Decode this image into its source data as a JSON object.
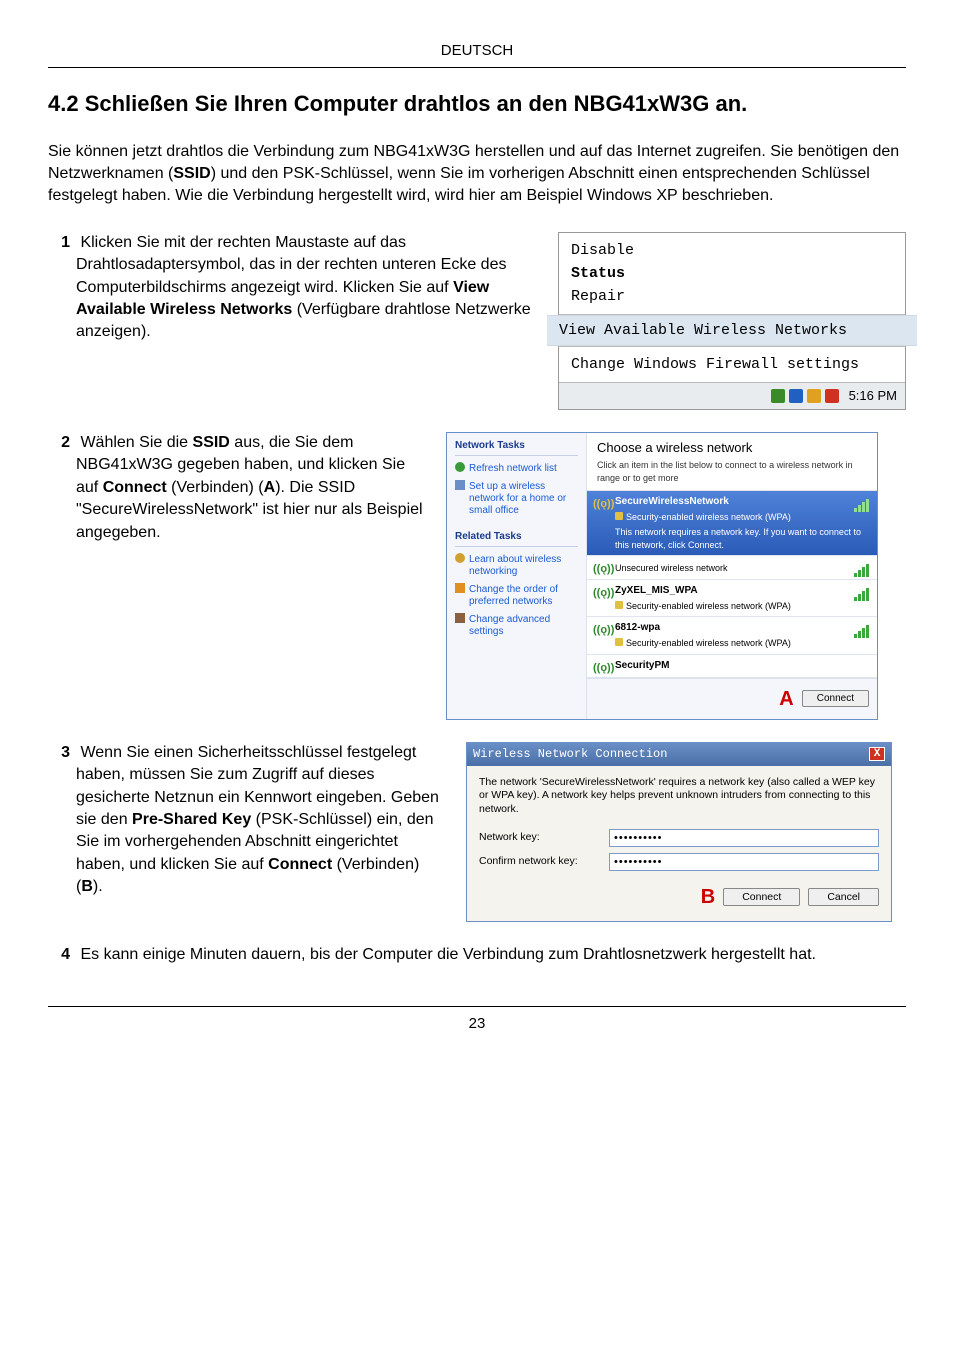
{
  "header": {
    "language": "DEUTSCH"
  },
  "section": {
    "title": "4.2 Schließen Sie Ihren Computer drahtlos an den NBG41xW3G an.",
    "intro_pre": "Sie können jetzt drahtlos die Verbindung zum NBG41xW3G herstellen und auf das Internet zugreifen. Sie benötigen den Netzwerknamen (",
    "intro_ssid": "SSID",
    "intro_post": ") und den PSK-Schlüssel, wenn Sie im vorherigen Abschnitt einen entsprechenden Schlüssel festgelegt haben. Wie die Verbindung hergestellt wird, wird hier am Beispiel Windows XP beschrieben."
  },
  "steps": {
    "s1": {
      "num": "1",
      "t1": "Klicken Sie mit der rechten Maustaste auf das Drahtlosadaptersymbol, das in der rechten unteren Ecke des Computerbildschirms angezeigt wird. Klicken Sie auf ",
      "b1": "View Available Wireless Networks",
      "t2": " (Verfügbare drahtlose Netzwerke anzeigen)."
    },
    "s2": {
      "num": "2",
      "t1": "Wählen Sie die ",
      "b1": "SSID",
      "t2": " aus, die Sie dem NBG41xW3G gegeben haben, und klicken Sie auf ",
      "b2": "Connect",
      "t3": " (Verbinden) (",
      "b3": "A",
      "t4": "). Die SSID \"SecureWirelessNetwork\" ist hier nur als Beispiel angegeben."
    },
    "s3": {
      "num": "3",
      "t1": "Wenn Sie einen Sicherheitsschlüssel festgelegt haben, müssen Sie zum Zugriff auf dieses gesicherte Netznun ein Kennwort eingeben. Geben sie den ",
      "b1": "Pre-Shared Key",
      "t2": " (PSK-Schlüssel) ein, den Sie im vorhergehenden Abschnitt eingerichtet haben, und klicken Sie auf ",
      "b2": "Connect",
      "t3": " (Verbinden) (",
      "b3": "B",
      "t4": ")."
    },
    "s4": {
      "num": "4",
      "t1": "Es kann einige Minuten dauern, bis der Computer die Verbindung zum Drahtlosnetzwerk hergestellt hat."
    }
  },
  "fig1": {
    "items": {
      "disable": "Disable",
      "status": "Status",
      "repair": "Repair",
      "view": "View Available Wireless Networks",
      "firewall": "Change Windows Firewall settings"
    },
    "tray_time": "5:16 PM"
  },
  "fig2": {
    "side": {
      "grp1": "Network Tasks",
      "refresh": "Refresh network list",
      "setup": "Set up a wireless network for a home or small office",
      "grp2": "Related Tasks",
      "learn": "Learn about wireless networking",
      "order": "Change the order of preferred networks",
      "adv": "Change advanced settings"
    },
    "main": {
      "hdr": "Choose a wireless network",
      "sub": "Click an item in the list below to connect to a wireless network in range or to get more",
      "networks": [
        {
          "name": "SecureWirelessNetwork",
          "type": "Security-enabled wireless network (WPA)",
          "note": "This network requires a network key. If you want to connect to this network, click Connect.",
          "sel": true
        },
        {
          "name": "Unsecured wireless network",
          "type": "Unsecured wireless network",
          "sel": false
        },
        {
          "name": "ZyXEL_MIS_WPA",
          "type": "Security-enabled wireless network (WPA)",
          "sel": false
        },
        {
          "name": "6812-wpa",
          "type": "Security-enabled wireless network (WPA)",
          "sel": false
        },
        {
          "name": "SecurityPM",
          "type": "",
          "sel": false
        }
      ],
      "labelA": "A",
      "connect": "Connect"
    }
  },
  "fig3": {
    "title": "Wireless Network Connection",
    "msg": "The network 'SecureWirelessNetwork' requires a network key (also called a WEP key or WPA key). A network key helps prevent unknown intruders from connecting to this network.",
    "lbl_key": "Network key:",
    "lbl_confirm": "Confirm network key:",
    "val_key": "••••••••••",
    "val_confirm": "••••••••••",
    "labelB": "B",
    "connect": "Connect",
    "cancel": "Cancel"
  },
  "footer": {
    "page": "23"
  }
}
